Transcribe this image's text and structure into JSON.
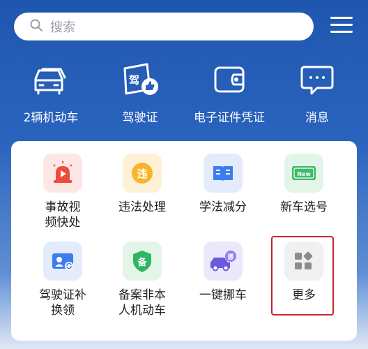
{
  "search": {
    "placeholder": "搜索"
  },
  "top_nav": [
    {
      "label": "2辆机动车",
      "icon": "car-icon"
    },
    {
      "label": "驾驶证",
      "icon": "license-icon"
    },
    {
      "label": "电子证件凭证",
      "icon": "wallet-icon"
    },
    {
      "label": "消息",
      "icon": "message-icon"
    }
  ],
  "services": [
    {
      "label": "事故视频快处",
      "icon": "siren-icon",
      "tile_color": "#fde7e5"
    },
    {
      "label": "违法处理",
      "icon": "violation-icon",
      "tile_color": "#fff1d6",
      "badge": "违"
    },
    {
      "label": "学法减分",
      "icon": "book-icon",
      "tile_color": "#e4ecfb"
    },
    {
      "label": "新车选号",
      "icon": "new-plate-icon",
      "tile_color": "#e3f4e8",
      "badge": "New"
    },
    {
      "label": "驾驶证补换领",
      "icon": "id-card-icon",
      "tile_color": "#e4ecfb"
    },
    {
      "label": "备案非本人机动车",
      "icon": "shield-icon",
      "tile_color": "#e3f4e8",
      "badge": "备"
    },
    {
      "label": "一键挪车",
      "icon": "move-car-icon",
      "tile_color": "#ece8fb",
      "badge": "挪"
    },
    {
      "label": "更多",
      "icon": "more-icon",
      "tile_color": "#f0f0f0"
    }
  ]
}
